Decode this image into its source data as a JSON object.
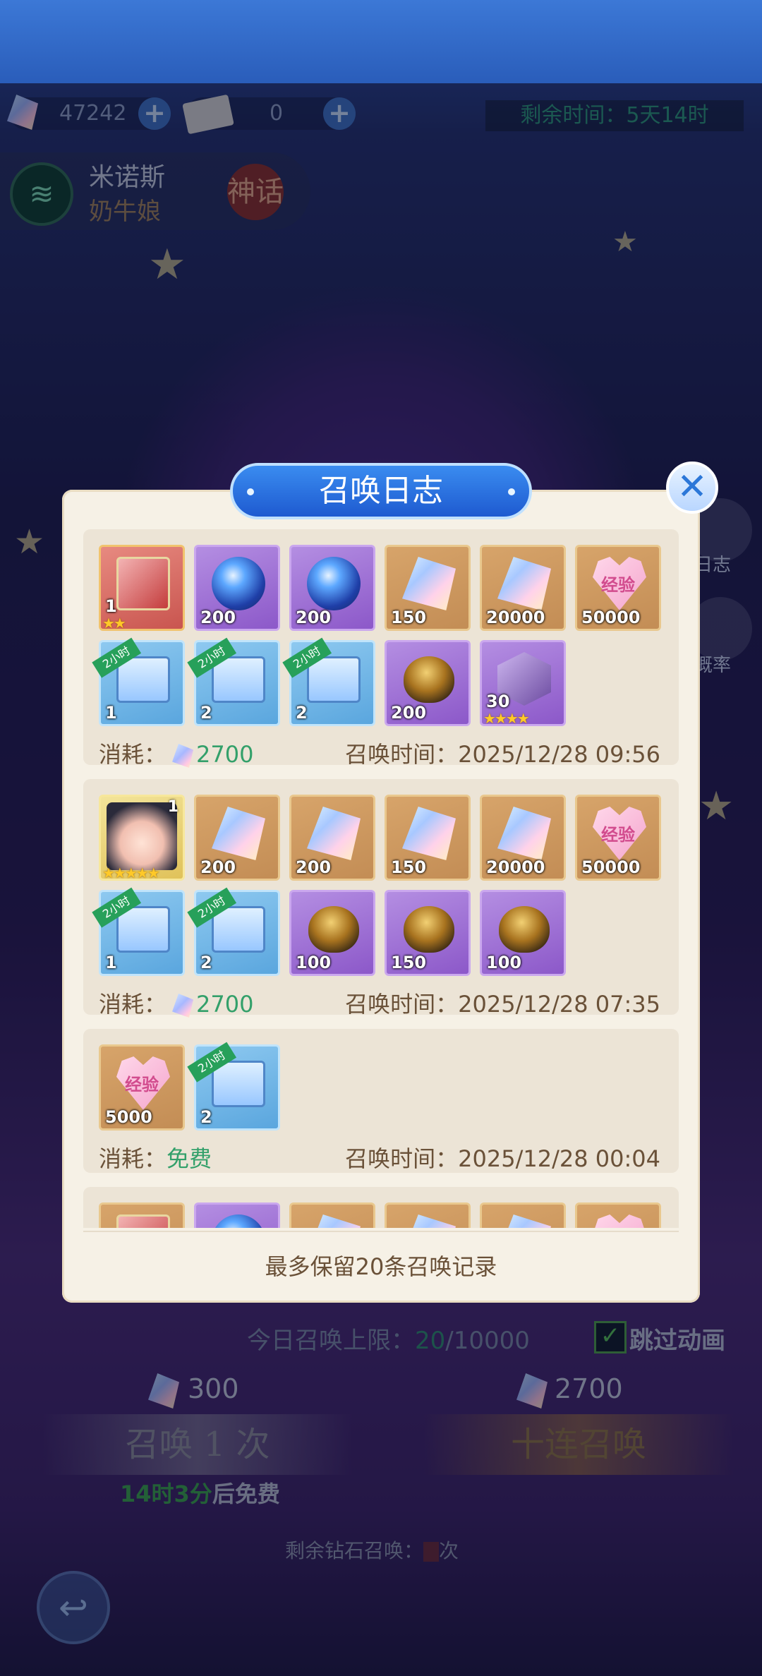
{
  "resources": {
    "diamonds": "47242",
    "tickets": "0",
    "remaining_label": "剩余时间：",
    "remaining_value": "5天14时"
  },
  "character": {
    "name": "米诺斯",
    "title": "奶牛娘",
    "rarity": "神话"
  },
  "side": {
    "log": "日志",
    "rate": "概率"
  },
  "modal": {
    "title": "召唤日志",
    "cost_label": "消耗：",
    "time_label": "召唤时间：",
    "footer": "最多保留20条召唤记录",
    "records": [
      {
        "cost": "2700",
        "time": "2025/12/28 09:56",
        "items": [
          {
            "type": "red",
            "art": "box",
            "qty": "1",
            "stars": "★★"
          },
          {
            "type": "purple",
            "art": "orb",
            "qty": "200"
          },
          {
            "type": "purple",
            "art": "orb",
            "qty": "200"
          },
          {
            "type": "gold",
            "art": "crystal",
            "qty": "150"
          },
          {
            "type": "gold",
            "art": "crystal",
            "qty": "20000"
          },
          {
            "type": "gold",
            "art": "heart",
            "qty": "50000",
            "label": "经验"
          },
          {
            "type": "blue",
            "art": "chest",
            "qty": "1",
            "tag": "2小时"
          },
          {
            "type": "blue",
            "art": "chest",
            "qty": "2",
            "tag": "2小时"
          },
          {
            "type": "blue",
            "art": "chest",
            "qty": "2",
            "tag": "2小时"
          },
          {
            "type": "purple",
            "art": "egg",
            "qty": "200"
          },
          {
            "type": "purple",
            "art": "shard",
            "qty": "30",
            "stars": "★★★★"
          }
        ]
      },
      {
        "cost": "2700",
        "time": "2025/12/28 07:35",
        "items": [
          {
            "type": "hero",
            "art": "face",
            "qty": "",
            "tr": "1",
            "stars": "★★★★★"
          },
          {
            "type": "gold",
            "art": "crystal",
            "qty": "200"
          },
          {
            "type": "gold",
            "art": "crystal",
            "qty": "200"
          },
          {
            "type": "gold",
            "art": "crystal",
            "qty": "150"
          },
          {
            "type": "gold",
            "art": "crystal",
            "qty": "20000"
          },
          {
            "type": "gold",
            "art": "heart",
            "qty": "50000",
            "label": "经验"
          },
          {
            "type": "blue",
            "art": "chest",
            "qty": "1",
            "tag": "2小时"
          },
          {
            "type": "blue",
            "art": "chest",
            "qty": "2",
            "tag": "2小时"
          },
          {
            "type": "purple",
            "art": "egg",
            "qty": "100"
          },
          {
            "type": "purple",
            "art": "egg",
            "qty": "150"
          },
          {
            "type": "purple",
            "art": "egg",
            "qty": "100"
          }
        ]
      },
      {
        "cost": "免费",
        "time": "2025/12/28 00:04",
        "items": [
          {
            "type": "gold",
            "art": "heart",
            "qty": "5000",
            "label": "经验"
          },
          {
            "type": "blue",
            "art": "chest",
            "qty": "2",
            "tag": "2小时"
          }
        ]
      },
      {
        "cost": "",
        "time": "",
        "items": [
          {
            "type": "gold",
            "art": "box",
            "qty": ""
          },
          {
            "type": "purple",
            "art": "orb",
            "qty": ""
          },
          {
            "type": "gold",
            "art": "crystal",
            "qty": ""
          },
          {
            "type": "gold",
            "art": "crystal",
            "qty": ""
          },
          {
            "type": "gold",
            "art": "crystal",
            "qty": ""
          },
          {
            "type": "gold",
            "art": "heart",
            "qty": ""
          }
        ]
      }
    ]
  },
  "bottom": {
    "daily_limit_label": "今日召唤上限：",
    "daily_used": "20",
    "daily_max": "/10000",
    "skip_anim": "跳过动画",
    "single_cost": "300",
    "ten_cost": "2700",
    "single_btn": "召唤 1 次",
    "ten_btn": "十连召唤",
    "free_timer": "14时3分",
    "free_suffix": "后免费",
    "diamond_remaining_label": "剩余钻石召唤：",
    "diamond_remaining_suffix": "次"
  },
  "colors": {
    "accent_green": "#33a06a",
    "modal_bg": "#f6f1e6",
    "title_blue": "#1e5ad0"
  }
}
